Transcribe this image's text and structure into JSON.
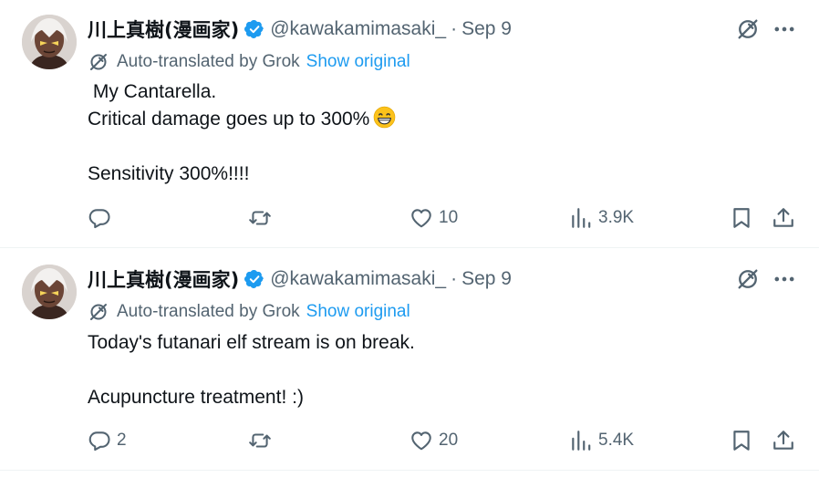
{
  "tweets": [
    {
      "author_name": "川上真樹(漫画家)",
      "handle": "@kawakamimasaki_",
      "separator": "·",
      "date": "Sep 9",
      "translation_note": "Auto-translated by Grok",
      "show_original_label": "Show original",
      "lines": [
        " My Cantarella.",
        "Critical damage goes up to 300%",
        "",
        "Sensitivity 300%!!!!"
      ],
      "emoji": "grinning-face",
      "replies": "",
      "retweets": "",
      "likes": "10",
      "views": "3.9K"
    },
    {
      "author_name": "川上真樹(漫画家)",
      "handle": "@kawakamimasaki_",
      "separator": "·",
      "date": "Sep 9",
      "translation_note": "Auto-translated by Grok",
      "show_original_label": "Show original",
      "lines": [
        "Today's futanari elf stream is on break.",
        "",
        "Acupuncture treatment! :)"
      ],
      "emoji": "",
      "replies": "2",
      "retweets": "",
      "likes": "20",
      "views": "5.4K"
    }
  ],
  "colors": {
    "text": "#0f1419",
    "secondary": "#536471",
    "link": "#1d9bf0",
    "verified": "#1d9bf0",
    "divider": "#eff3f4"
  }
}
